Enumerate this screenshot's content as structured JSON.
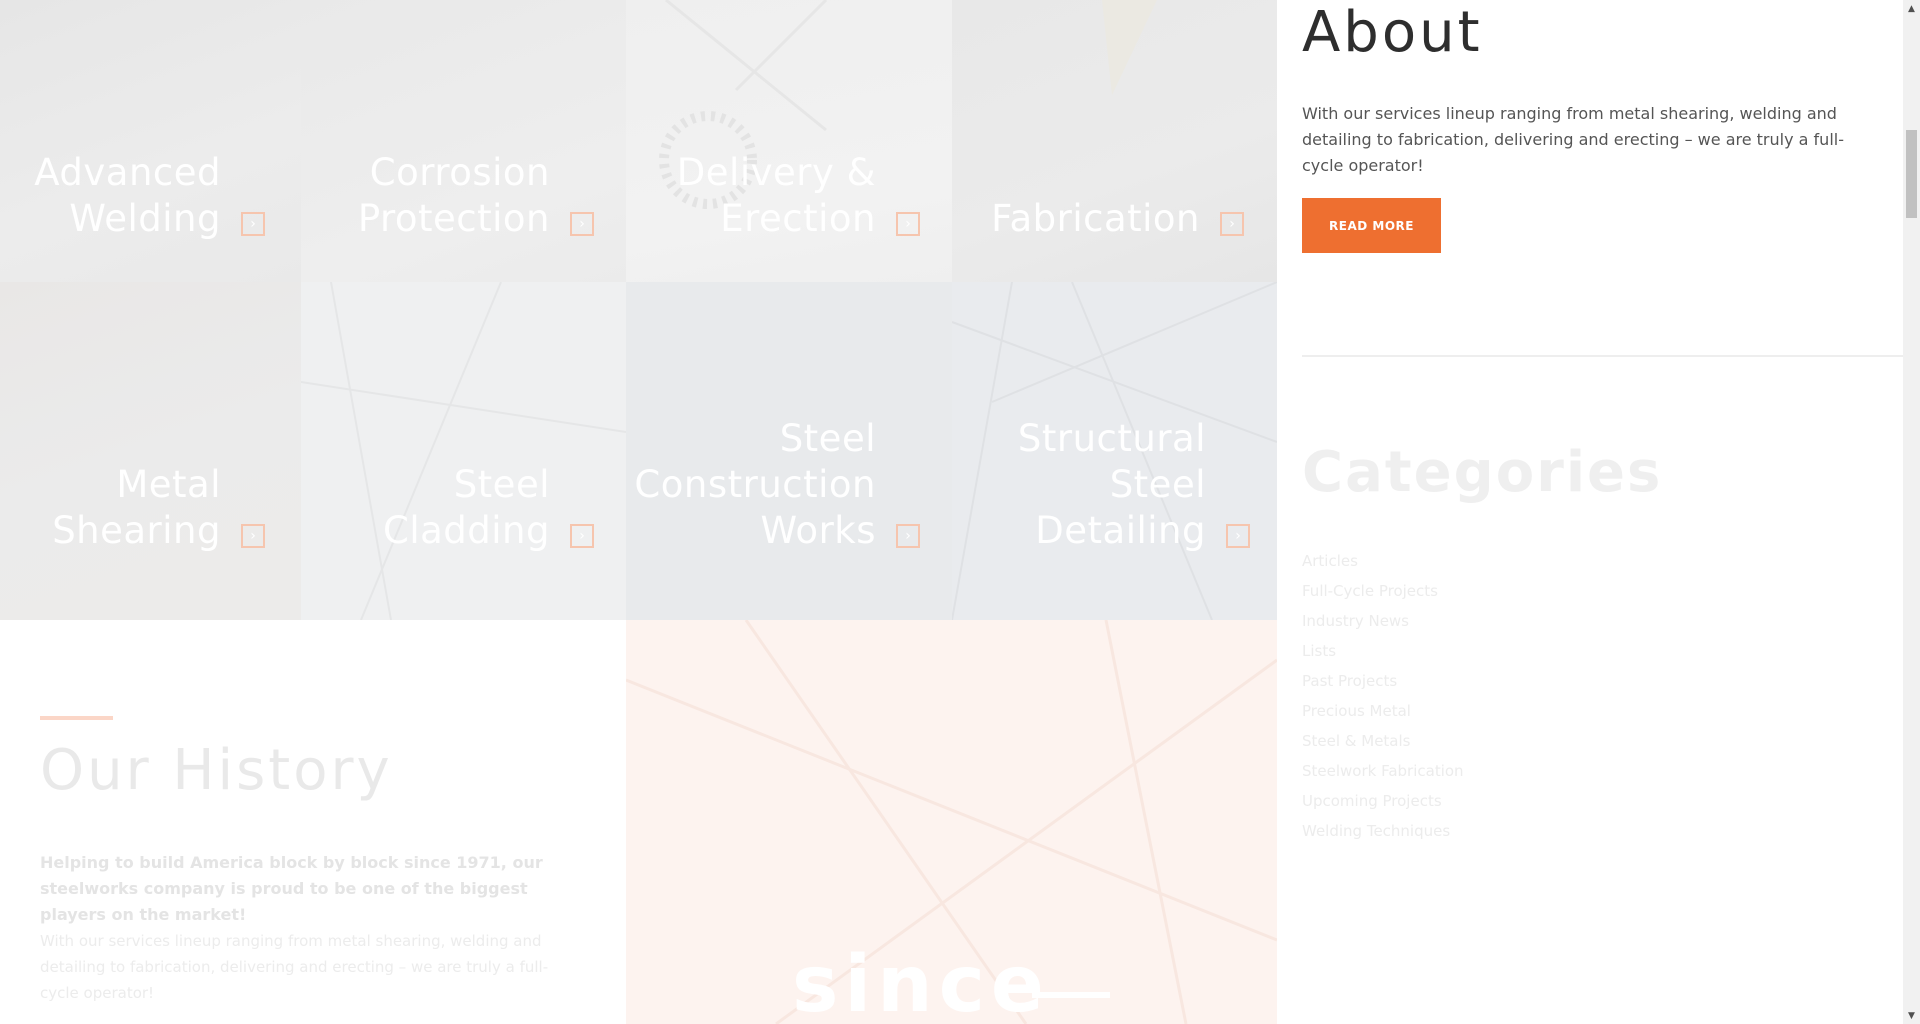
{
  "services": [
    {
      "label": "Advanced\nWelding"
    },
    {
      "label": "Corrosion\nProtection"
    },
    {
      "label": "Delivery &\nErection"
    },
    {
      "label": "Fabrication"
    },
    {
      "label": "Metal\nShearing"
    },
    {
      "label": "Steel\nCladding"
    },
    {
      "label": "Steel\nConstruction\nWorks"
    },
    {
      "label": "Structural\nSteel\nDetailing"
    }
  ],
  "history": {
    "title": "Our History",
    "lead": "Helping to build America block by block since 1971, our steelworks company is proud to be one of the biggest players on the market!",
    "body": "With our services lineup ranging from metal shearing, welding and detailing to fabrication, delivering and erecting – we are truly a full-cycle operator!",
    "since": "since"
  },
  "sidebar": {
    "about_title": "About",
    "about_text": "With our services lineup ranging from metal shearing, welding and detailing to fabrication, delivering and erecting – we are truly a full-cycle operator!",
    "read_more": "READ MORE",
    "categories_title": "Categories",
    "categories": [
      "Articles",
      "Full-Cycle Projects",
      "Industry News",
      "Lists",
      "Past Projects",
      "Precious Metal",
      "Steel & Metals",
      "Steelwork Fabrication",
      "Upcoming Projects",
      "Welding Techniques"
    ]
  },
  "colors": {
    "accent": "#ee6f30"
  },
  "icons": {
    "tile_arrow": "chevron-right-icon",
    "scroll_up": "scroll-up-arrow-icon",
    "scroll_down": "scroll-down-arrow-icon"
  }
}
